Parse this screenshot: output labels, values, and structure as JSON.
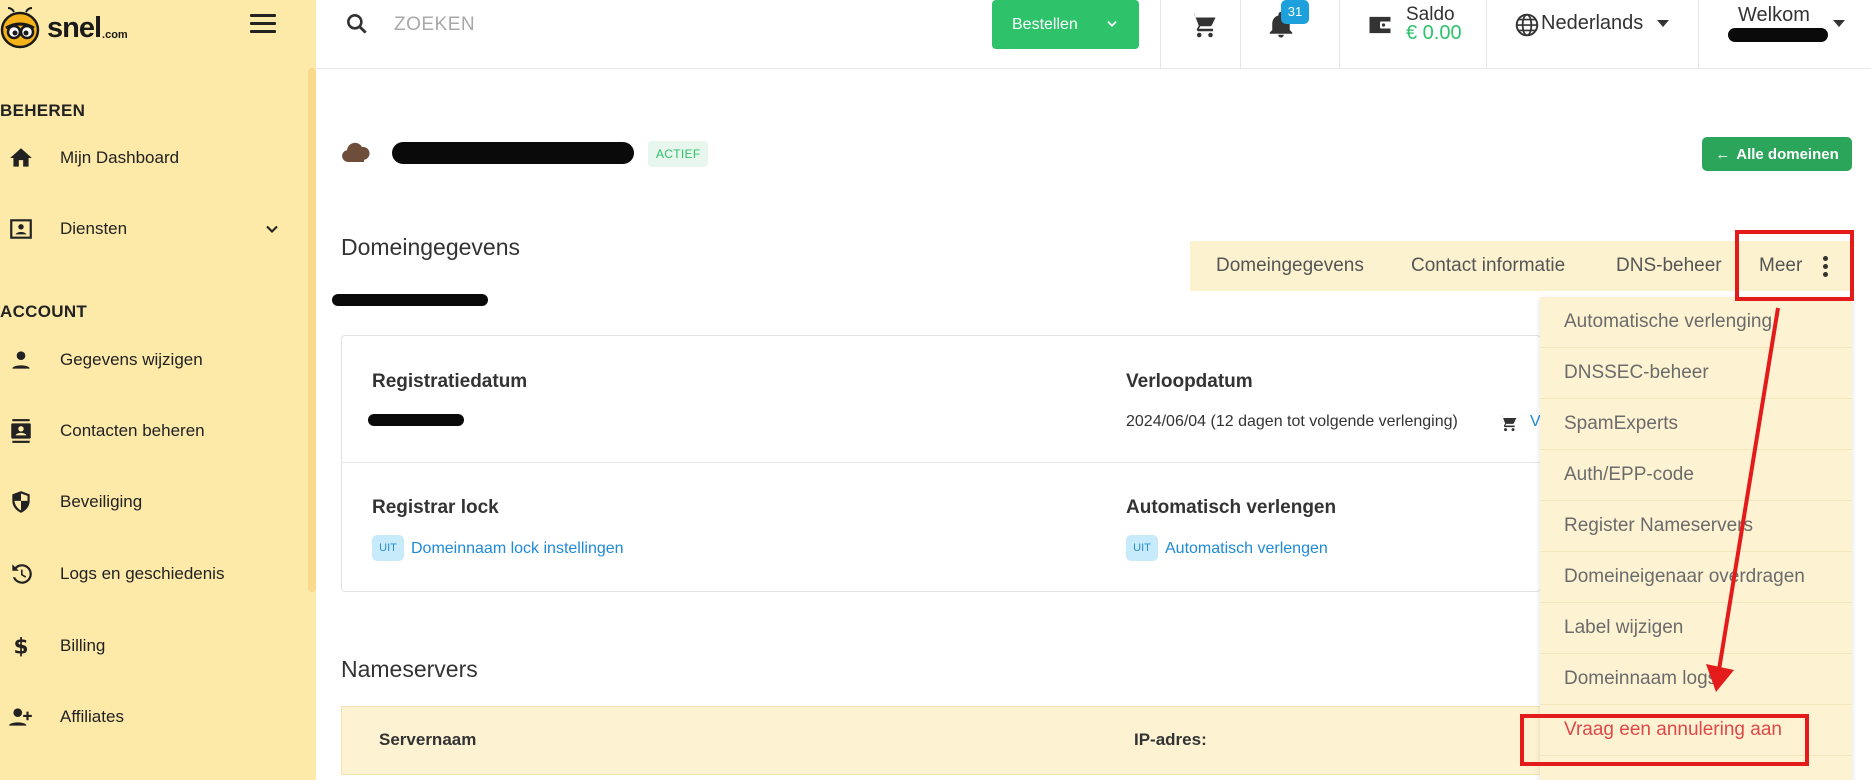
{
  "brand": {
    "name": "snel",
    "suffix": ".com"
  },
  "sidebar": {
    "sections": [
      {
        "label": "BEHEREN"
      },
      {
        "label": "ACCOUNT"
      }
    ],
    "items": [
      {
        "label": "Mijn Dashboard",
        "icon": "home-icon"
      },
      {
        "label": "Diensten",
        "icon": "id-card-icon"
      },
      {
        "label": "Gegevens wijzigen",
        "icon": "person-icon"
      },
      {
        "label": "Contacten beheren",
        "icon": "contacts-icon"
      },
      {
        "label": "Beveiliging",
        "icon": "shield-icon"
      },
      {
        "label": "Logs en geschiedenis",
        "icon": "history-icon"
      },
      {
        "label": "Billing",
        "icon": "dollar-icon"
      },
      {
        "label": "Affiliates",
        "icon": "person-add-icon"
      }
    ]
  },
  "topbar": {
    "search_placeholder": "ZOEKEN",
    "order_label": "Bestellen",
    "notifications_count": "31",
    "saldo_label": "Saldo",
    "saldo_value": "€ 0.00",
    "language": "Nederlands",
    "welcome": "Welkom"
  },
  "domain": {
    "status": "ACTIEF",
    "all_domains_label": "Alle domeinen"
  },
  "details": {
    "title": "Domeingegevens",
    "tabs": [
      "Domeingegevens",
      "Contact informatie",
      "DNS-beheer",
      "Meer"
    ],
    "registration_label": "Registratiedatum",
    "expiry_label": "Verloopdatum",
    "expiry_value": "2024/06/04 (12 dagen tot volgende verlenging)",
    "expiry_link": "V",
    "registrar_lock_label": "Registrar lock",
    "registrar_lock_badge": "UIT",
    "registrar_lock_link": "Domeinnaam lock instellingen",
    "auto_renew_label": "Automatisch verlengen",
    "auto_renew_badge": "UIT",
    "auto_renew_link": "Automatisch verlengen"
  },
  "nameservers": {
    "title": "Nameservers",
    "columns": [
      "Servernaam",
      "IP-adres:"
    ]
  },
  "dropdown": {
    "items": [
      "Automatische verlenging",
      "DNSSEC-beheer",
      "SpamExperts",
      "Auth/EPP-code",
      "Register Nameservers",
      "Domeineigenaar overdragen",
      "Label wijzigen",
      "Domeinnaam logs",
      "Vraag een annulering aan"
    ]
  },
  "colors": {
    "sidebar_bg": "#fde9a8",
    "accent_green": "#2ec26b",
    "link_blue": "#1e8ad6",
    "annotation_red": "#e41b1b"
  }
}
